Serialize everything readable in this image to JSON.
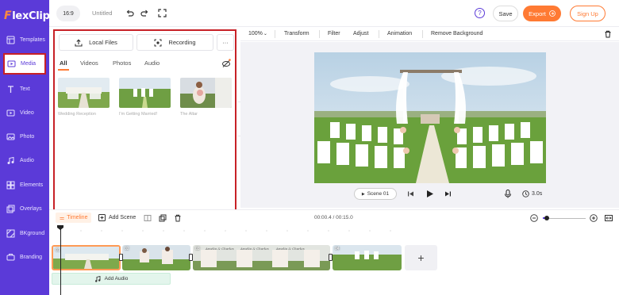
{
  "app": {
    "logo_text": "lexClip",
    "logo_f": "F"
  },
  "sidebar": {
    "items": [
      {
        "label": "Templates",
        "icon": "templates-icon"
      },
      {
        "label": "Media",
        "icon": "media-icon",
        "active": true
      },
      {
        "label": "Text",
        "icon": "text-icon"
      },
      {
        "label": "Video",
        "icon": "video-icon"
      },
      {
        "label": "Photo",
        "icon": "photo-icon"
      },
      {
        "label": "Audio",
        "icon": "audio-icon"
      },
      {
        "label": "Elements",
        "icon": "elements-icon"
      },
      {
        "label": "Overlays",
        "icon": "overlays-icon"
      },
      {
        "label": "BKground",
        "icon": "background-icon"
      },
      {
        "label": "Branding",
        "icon": "branding-icon"
      }
    ]
  },
  "topbar": {
    "ratio": "16:9",
    "title": "Untitled",
    "help": "?",
    "save_label": "Save",
    "export_label": "Export",
    "signup_label": "Sign Up"
  },
  "media_panel": {
    "local_files_label": "Local Files",
    "recording_label": "Recording",
    "more_label": "···",
    "tabs": [
      "All",
      "Videos",
      "Photos",
      "Audio"
    ],
    "active_tab": "All",
    "items": [
      {
        "label": "Wedding Reception"
      },
      {
        "label": "I'm Getting Married!"
      },
      {
        "label": "The Altar"
      }
    ]
  },
  "edit_toolbar": {
    "zoom": "100%",
    "items": [
      "Transform",
      "Filter",
      "Adjust",
      "Animation",
      "Remove Background"
    ]
  },
  "playback": {
    "scene_label": "Scene 01",
    "duration": "3.0s"
  },
  "timeline": {
    "tab_label": "Timeline",
    "add_scene_label": "Add Scene",
    "time": "00:00.4 / 00:15.0",
    "zoom_fraction": 0.1,
    "clips": [
      {
        "num": "01",
        "selected": true
      },
      {
        "num": "02"
      },
      {
        "num": "03"
      },
      {
        "num": "04"
      }
    ],
    "add_clip_label": "+",
    "add_audio_label": "Add Audio"
  },
  "colors": {
    "sidebar": "#5b3ad8",
    "accent": "#ff7a33",
    "highlight": "#c72127"
  }
}
